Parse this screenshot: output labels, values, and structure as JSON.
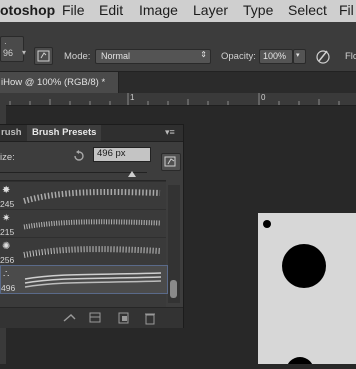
{
  "menubar": {
    "app": "otoshop",
    "items": [
      "File",
      "Edit",
      "Image",
      "Layer",
      "Type",
      "Select",
      "Fil"
    ]
  },
  "options": {
    "size_value": "96",
    "mode_label": "Mode:",
    "mode_value": "Normal",
    "opacity_label": "Opacity:",
    "opacity_value": "100%",
    "flow_label": "Flo"
  },
  "document_tab": {
    "title": "iHow @ 100% (RGB/8) *"
  },
  "ruler": {
    "ticks": [
      "1",
      "0"
    ]
  },
  "brush_panel": {
    "tabs": [
      "rush",
      "Brush Presets"
    ],
    "size_label": "ize:",
    "size_value": "496 px",
    "presets": [
      {
        "size": "245",
        "selected": false
      },
      {
        "size": "215",
        "selected": false
      },
      {
        "size": "256",
        "selected": false
      },
      {
        "size": "496",
        "selected": true
      }
    ]
  },
  "colors": {
    "menubar": "#cfcfcf",
    "panel": "#3d3d3d",
    "canvas": "#282828",
    "document": "#d7d7d7"
  }
}
